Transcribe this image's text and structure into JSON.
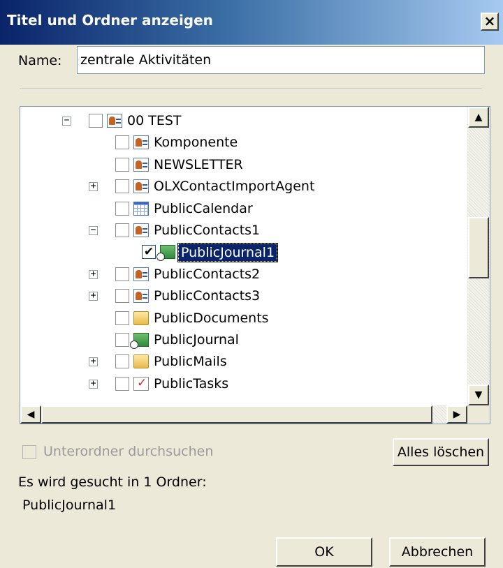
{
  "window": {
    "title": "Titel und Ordner anzeigen",
    "close_glyph": "×"
  },
  "name_field": {
    "label": "Name:",
    "value": "zentrale Aktivitäten"
  },
  "tree": {
    "items": [
      {
        "label": "00 TEST",
        "icon": "contacts-icon",
        "expander": "−",
        "checked": false
      },
      {
        "label": "Komponente",
        "icon": "contacts-icon",
        "expander": "",
        "checked": false
      },
      {
        "label": "NEWSLETTER",
        "icon": "contacts-icon",
        "expander": "",
        "checked": false
      },
      {
        "label": "OLXContactImportAgent",
        "icon": "contacts-icon",
        "expander": "+",
        "checked": false
      },
      {
        "label": "PublicCalendar",
        "icon": "calendar-icon",
        "expander": "",
        "checked": false
      },
      {
        "label": "PublicContacts1",
        "icon": "contacts-icon",
        "expander": "−",
        "checked": false
      },
      {
        "label": "PublicJournal1",
        "icon": "journal-icon",
        "expander": "",
        "checked": true,
        "selected": true
      },
      {
        "label": "PublicContacts2",
        "icon": "contacts-icon",
        "expander": "+",
        "checked": false
      },
      {
        "label": "PublicContacts3",
        "icon": "contacts-icon",
        "expander": "+",
        "checked": false
      },
      {
        "label": "PublicDocuments",
        "icon": "folder-icon",
        "expander": "",
        "checked": false
      },
      {
        "label": "PublicJournal",
        "icon": "journal-icon",
        "expander": "",
        "checked": false
      },
      {
        "label": "PublicMails",
        "icon": "folder-icon",
        "expander": "+",
        "checked": false
      },
      {
        "label": "PublicTasks",
        "icon": "tasks-icon",
        "expander": "+",
        "checked": false
      }
    ],
    "scroll_up_glyph": "▲",
    "scroll_down_glyph": "▼",
    "scroll_left_glyph": "◀",
    "scroll_right_glyph": "▶"
  },
  "search_subfolders": {
    "label": "Unterordner durchsuchen",
    "checked": false,
    "enabled": false
  },
  "clear_button": "Alles löschen",
  "search_info": {
    "text": "Es wird gesucht in 1 Ordner:",
    "folders": "PublicJournal1"
  },
  "buttons": {
    "ok": "OK",
    "cancel": "Abbrechen"
  }
}
